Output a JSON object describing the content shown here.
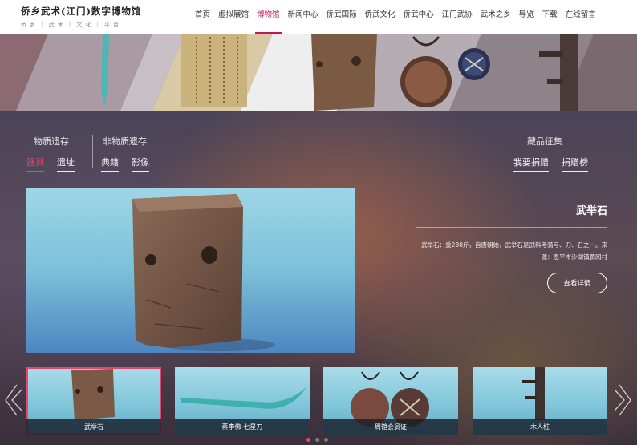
{
  "header": {
    "logo_title": "侨乡武术(江门)数字博物馆",
    "logo_sub": [
      "侨 乡",
      "武 术",
      "文 化",
      "平 台"
    ],
    "nav": [
      "首页",
      "虚拟展馆",
      "博物馆",
      "新闻中心",
      "侨武国际",
      "侨武文化",
      "侨武中心",
      "江门武协",
      "武术之乡",
      "导览",
      "下载",
      "在线留言"
    ],
    "active_nav": "博物馆"
  },
  "categories": {
    "material": {
      "title": "物质遗存",
      "links": [
        "器具",
        "遗址"
      ],
      "active": "器具"
    },
    "intangible": {
      "title": "非物质遗存",
      "links": [
        "典籍",
        "影像"
      ]
    },
    "collection": {
      "title": "藏品征集",
      "links": [
        "我要捐赠",
        "捐赠榜"
      ]
    }
  },
  "featured": {
    "title": "武举石",
    "description": "武举石：重230斤，自唐朝始，武举石是武科考骑弓、刀、石之一。来源：恩平市沙湖镇鹏冈村",
    "detail_button": "查看详情"
  },
  "thumbnails": [
    {
      "caption": "武举石",
      "active": true
    },
    {
      "caption": "蔡李佛-七星刀",
      "active": false
    },
    {
      "caption": "周馆会员证",
      "active": false
    },
    {
      "caption": "木人桩",
      "active": false
    }
  ],
  "pagination": {
    "count": 3,
    "current": 1
  },
  "colors": {
    "accent": "#e9466f",
    "nav_active": "#c2185b"
  },
  "icons": {
    "prev": "double-chevron-left-icon",
    "next": "double-chevron-right-icon"
  }
}
